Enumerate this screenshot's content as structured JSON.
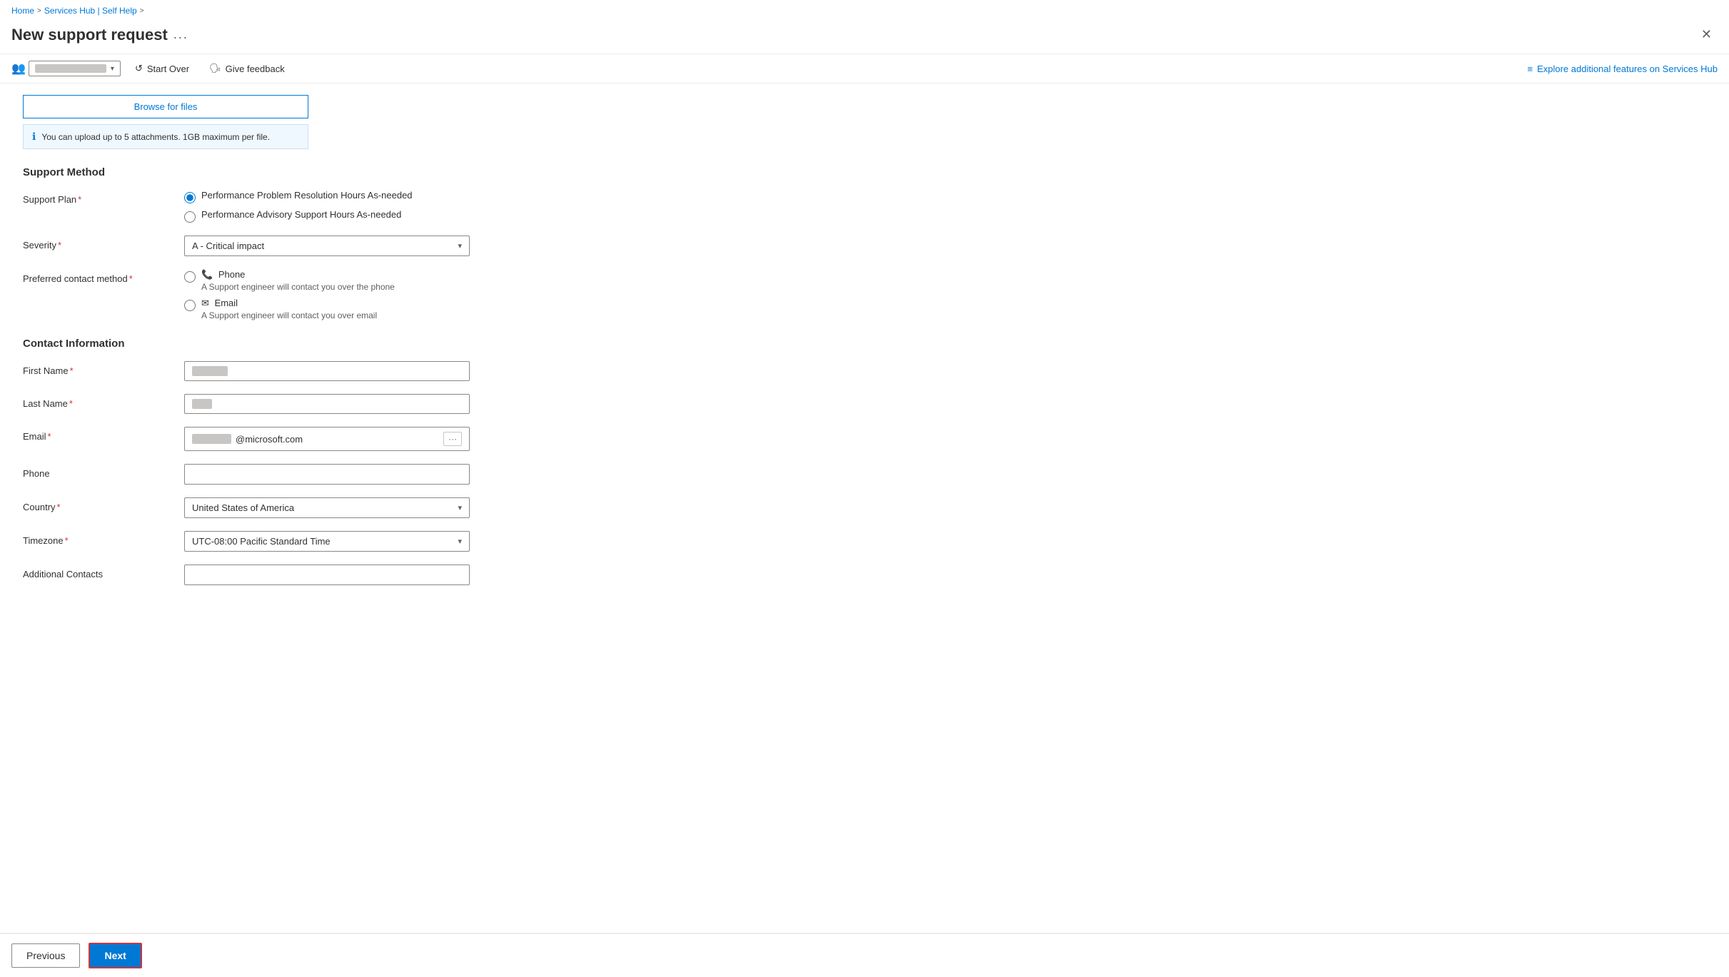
{
  "breadcrumb": {
    "home": "Home",
    "services_hub": "Services Hub | Self Help",
    "sep": ">"
  },
  "header": {
    "title": "New support request",
    "more_label": "...",
    "close_label": "✕"
  },
  "toolbar": {
    "tenant_bar_label": "",
    "start_over_label": "Start Over",
    "give_feedback_label": "Give feedback",
    "explore_label": "Explore additional features on Services Hub"
  },
  "browse_section": {
    "browse_btn_label": "Browse for files",
    "info_text": "You can upload up to 5 attachments. 1GB maximum per file."
  },
  "support_method": {
    "section_title": "Support Method",
    "support_plan_label": "Support Plan",
    "support_plan_required": true,
    "plan_options": [
      {
        "id": "plan1",
        "label": "Performance Problem Resolution Hours As-needed",
        "checked": true
      },
      {
        "id": "plan2",
        "label": "Performance Advisory Support Hours As-needed",
        "checked": false
      }
    ],
    "severity_label": "Severity",
    "severity_required": true,
    "severity_value": "A - Critical impact",
    "preferred_contact_label": "Preferred contact method",
    "preferred_contact_required": true,
    "contact_options": [
      {
        "id": "phone",
        "icon": "📞",
        "label": "Phone",
        "sublabel": "A Support engineer will contact you over the phone",
        "checked": false
      },
      {
        "id": "email",
        "icon": "✉",
        "label": "Email",
        "sublabel": "A Support engineer will contact you over email",
        "checked": false
      }
    ]
  },
  "contact_info": {
    "section_title": "Contact Information",
    "first_name_label": "First Name",
    "first_name_required": true,
    "first_name_value": "",
    "first_name_placeholder": "",
    "last_name_label": "Last Name",
    "last_name_required": true,
    "last_name_value": "",
    "email_label": "Email",
    "email_required": true,
    "email_suffix": "@microsoft.com",
    "phone_label": "Phone",
    "phone_value": "",
    "phone_placeholder": "",
    "country_label": "Country",
    "country_required": true,
    "country_value": "United States of America",
    "timezone_label": "Timezone",
    "timezone_required": true,
    "timezone_value": "UTC-08:00 Pacific Standard Time",
    "additional_contacts_label": "Additional Contacts",
    "additional_contacts_placeholder": ""
  },
  "footer": {
    "previous_label": "Previous",
    "next_label": "Next"
  }
}
